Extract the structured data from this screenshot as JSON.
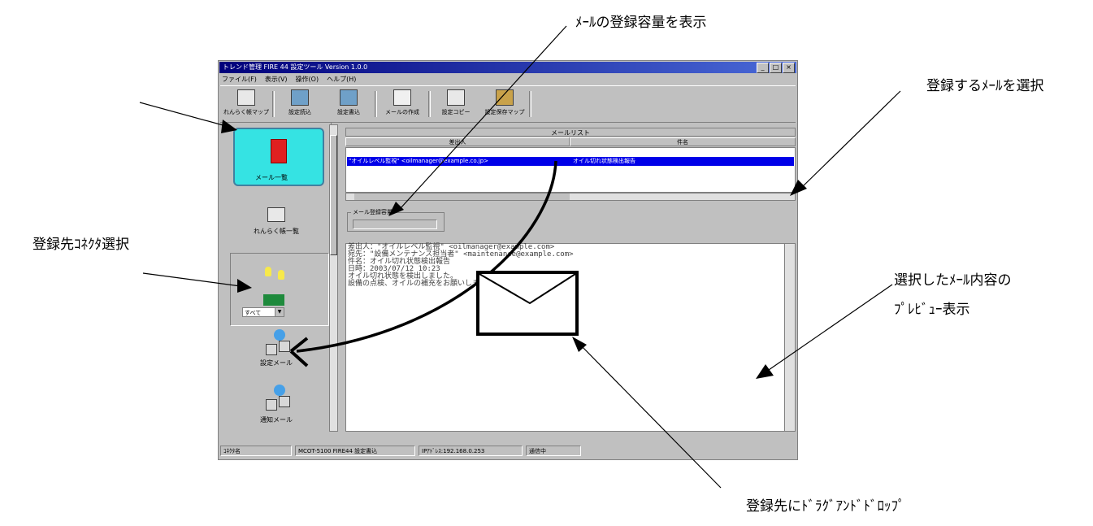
{
  "callouts": {
    "capacity": "ﾒｰﾙの登録容量を表示",
    "select_mail": "登録するﾒｰﾙを選択",
    "connector": "登録先ｺﾈｸﾀ選択",
    "preview_line1": "選択したﾒｰﾙ内容の",
    "preview_line2": "ﾌﾟﾚﾋﾞｭｰ表示",
    "drag_drop": "登録先にﾄﾞﾗｸﾞｱﾝﾄﾞﾄﾞﾛｯﾌﾟ"
  },
  "window": {
    "title": "トレンド管理 FIRE 44 設定ツール Version 1.0.0",
    "controls": [
      "_",
      "□",
      "×"
    ],
    "menu": [
      "ファイル(F)",
      "表示(V)",
      "操作(O)",
      "ヘルプ(H)"
    ],
    "toolbar": [
      "れんらく帳マップ",
      "設定読込",
      "設定書込",
      "メールの作成",
      "設定コピー",
      "設定保存マップ"
    ]
  },
  "sidebar": {
    "mail_list": "メール一覧",
    "contacts": "れんらく帳一覧",
    "combo_value": "すべて",
    "device1": "設定メール",
    "device2": "通知メール"
  },
  "list": {
    "header": "メールリスト",
    "col_sender": "差出人",
    "col_subject": "件名",
    "row_sender": "\"オイルレベル監視\" <oilmanager@example.co.jp>",
    "row_subject": "オイル切れ状態検出報告"
  },
  "capacity": {
    "label": "メール登録容量"
  },
  "preview": {
    "lines": [
      "差出人：\"オイルレベル監視\" <oilmanager@example.com>",
      "宛先：\"設備メンテナンス担当者\" <maintenance@example.com>",
      "件名：オイル切れ状態検出報告",
      "日時：2003/07/12 10:23",
      "",
      "オイル切れ状態を検出しました。",
      "設備の点検、オイルの補充をお願いします。"
    ]
  },
  "status": [
    "ｺﾈｸﾀ名",
    "MCOT-5100 FIRE44 設定書込",
    "IPｱﾄﾞﾚｽ:192.168.0.253",
    "通信中"
  ]
}
